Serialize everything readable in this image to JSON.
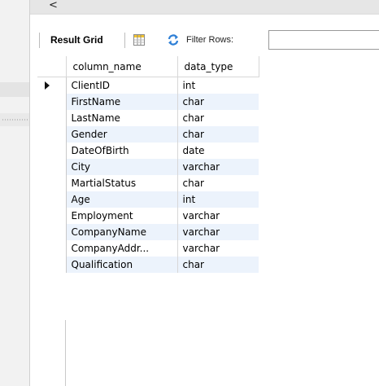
{
  "toolbar": {
    "back_label": "<",
    "result_grid_label": "Result Grid",
    "filter_rows_label": "Filter Rows:",
    "filter_value": ""
  },
  "grid": {
    "columns": [
      "column_name",
      "data_type"
    ],
    "rows": [
      {
        "column_name": "ClientID",
        "data_type": "int"
      },
      {
        "column_name": "FirstName",
        "data_type": "char"
      },
      {
        "column_name": "LastName",
        "data_type": "char"
      },
      {
        "column_name": "Gender",
        "data_type": "char"
      },
      {
        "column_name": "DateOfBirth",
        "data_type": "date"
      },
      {
        "column_name": "City",
        "data_type": "varchar"
      },
      {
        "column_name": "MartialStatus",
        "data_type": "char"
      },
      {
        "column_name": "Age",
        "data_type": "int"
      },
      {
        "column_name": "Employment",
        "data_type": "varchar"
      },
      {
        "column_name": "CompanyName",
        "data_type": "varchar"
      },
      {
        "column_name": "CompanyAddr...",
        "data_type": "varchar"
      },
      {
        "column_name": "Qualification",
        "data_type": "char"
      }
    ],
    "current_row_index": 0
  },
  "colors": {
    "alt_row": "#ecf3fc",
    "grid_line": "#d7d7d7",
    "refresh_icon": "#2e7fd6"
  },
  "icons": {
    "row_pointer": "triangle-right-icon",
    "grid_view": "grid-icon",
    "refresh": "refresh-icon"
  }
}
